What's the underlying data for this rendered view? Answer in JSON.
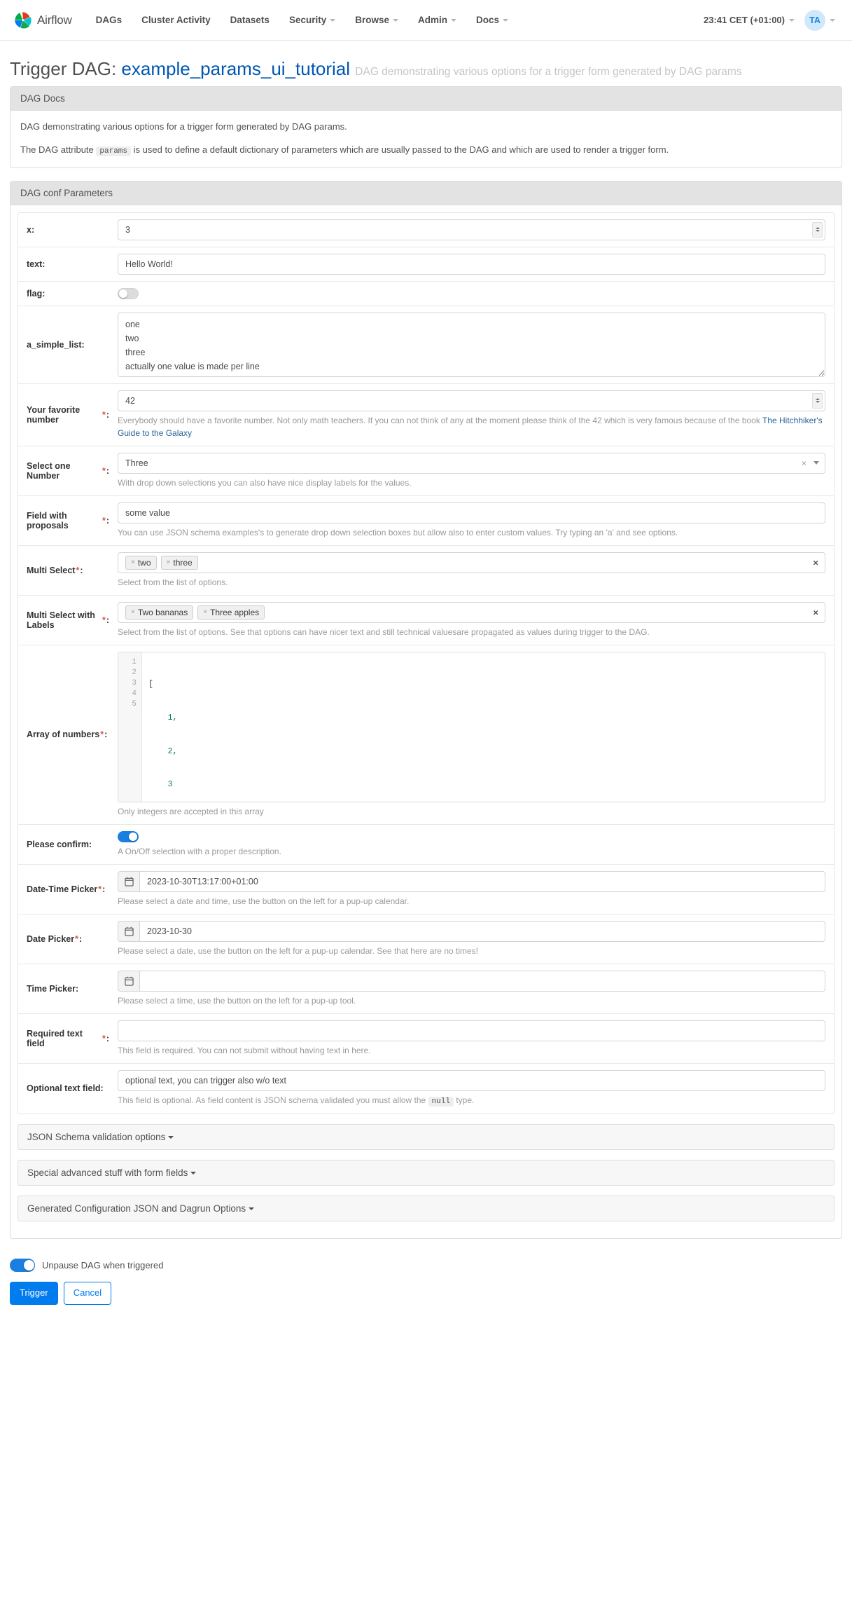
{
  "navbar": {
    "brand": "Airflow",
    "links": [
      {
        "label": "DAGs",
        "dropdown": false
      },
      {
        "label": "Cluster Activity",
        "dropdown": false
      },
      {
        "label": "Datasets",
        "dropdown": false
      },
      {
        "label": "Security",
        "dropdown": true
      },
      {
        "label": "Browse",
        "dropdown": true
      },
      {
        "label": "Admin",
        "dropdown": true
      },
      {
        "label": "Docs",
        "dropdown": true
      }
    ],
    "timezone": "23:41 CET (+01:00)",
    "user_initials": "TA"
  },
  "page": {
    "title_prefix": "Trigger DAG:",
    "dag_id": "example_params_ui_tutorial",
    "subtitle": "DAG demonstrating various options for a trigger form generated by DAG params"
  },
  "dag_docs": {
    "header": "DAG Docs",
    "paragraph1": "DAG demonstrating various options for a trigger form generated by DAG params.",
    "paragraph2_a": "The DAG attribute",
    "paragraph2_code": "params",
    "paragraph2_b": "is used to define a default dictionary of parameters which are usually passed to the DAG and which are used to render a trigger form."
  },
  "conf_params": {
    "header": "DAG conf Parameters",
    "fields": {
      "x": {
        "label": "x:",
        "value": "3"
      },
      "text": {
        "label": "text:",
        "value": "Hello World!"
      },
      "flag": {
        "label": "flag:",
        "on": false
      },
      "a_simple_list": {
        "label": "a_simple_list:",
        "value": "one\ntwo\nthree\nactually one value is made per line"
      },
      "favorite_number": {
        "label": "Your favorite number",
        "required": "*",
        "suffix": ":",
        "value": "42",
        "help_a": "Everybody should have a favorite number. Not only math teachers. If you can not think of any at the moment please think of the 42 which is very famous because of the book ",
        "help_link": "The Hitchhiker's Guide to the Galaxy"
      },
      "select_one_number": {
        "label": "Select one Number",
        "required": "*",
        "suffix": ":",
        "value": "Three",
        "help": "With drop down selections you can also have nice display labels for the values."
      },
      "field_with_proposals": {
        "label": "Field with proposals",
        "required": "*",
        "suffix": ":",
        "value": "some value",
        "help": "You can use JSON schema examples's to generate drop down selection boxes but allow also to enter custom values. Try typing an 'a' and see options."
      },
      "multi_select": {
        "label": "Multi Select",
        "required": "*",
        "suffix": ":",
        "tags": [
          "two",
          "three"
        ],
        "help": "Select from the list of options."
      },
      "multi_select_labels": {
        "label": "Multi Select with Labels",
        "required": "*",
        "suffix": ":",
        "tags": [
          "Two bananas",
          "Three apples"
        ],
        "help": "Select from the list of options. See that options can have nicer text and still technical valuesare propagated as values during trigger to the DAG."
      },
      "array_of_numbers": {
        "label": "Array of numbers",
        "required": "*",
        "suffix": ":",
        "line_numbers": [
          "1",
          "2",
          "3",
          "4",
          "5"
        ],
        "code_lines": [
          {
            "text": "[",
            "type": "pun"
          },
          {
            "text": "    1,",
            "type": "num"
          },
          {
            "text": "    2,",
            "type": "num"
          },
          {
            "text": "    3",
            "type": "num"
          },
          {
            "text": "]",
            "type": "pun"
          }
        ],
        "help": "Only integers are accepted in this array"
      },
      "please_confirm": {
        "label": "Please confirm:",
        "on": true,
        "help": "A On/Off selection with a proper description."
      },
      "datetime_picker": {
        "label": "Date-Time Picker",
        "required": "*",
        "suffix": ":",
        "value": "2023-10-30T13:17:00+01:00",
        "help": "Please select a date and time, use the button on the left for a pup-up calendar."
      },
      "date_picker": {
        "label": "Date Picker",
        "required": "*",
        "suffix": ":",
        "value": "2023-10-30",
        "help": "Please select a date, use the button on the left for a pup-up calendar. See that here are no times!"
      },
      "time_picker": {
        "label": "Time Picker:",
        "value": "",
        "help": "Please select a time, use the button on the left for a pup-up tool."
      },
      "required_text": {
        "label": "Required text field",
        "required": "*",
        "suffix": ":",
        "value": "",
        "help": "This field is required. You can not submit without having text in here."
      },
      "optional_text": {
        "label": "Optional text field:",
        "value": "optional text, you can trigger also w/o text",
        "help_a": "This field is optional. As field content is JSON schema validated you must allow the",
        "help_code": "null",
        "help_b": "type."
      }
    },
    "accordions": [
      {
        "label": "JSON Schema validation options"
      },
      {
        "label": "Special advanced stuff with form fields"
      },
      {
        "label": "Generated Configuration JSON and Dagrun Options"
      }
    ]
  },
  "footer": {
    "unpause_label": "Unpause DAG when triggered",
    "unpause_on": true,
    "trigger_label": "Trigger",
    "cancel_label": "Cancel"
  },
  "colors": {
    "primary": "#017cee",
    "link": "#0056b3",
    "required": "#d9534f",
    "panel_head": "#e3e3e3"
  }
}
